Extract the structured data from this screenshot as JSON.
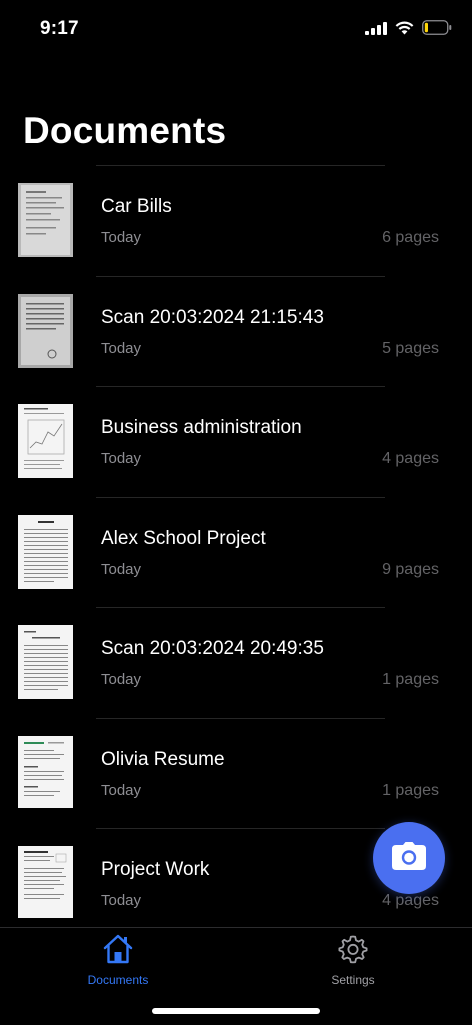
{
  "status_bar": {
    "time": "9:17"
  },
  "page": {
    "title": "Documents"
  },
  "documents": [
    {
      "name": "Car Bills",
      "date": "Today",
      "pages": "6 pages",
      "thumb_style": "photo"
    },
    {
      "name": "Scan 20:03:2024 21:15:43",
      "date": "Today",
      "pages": "5 pages",
      "thumb_style": "photo"
    },
    {
      "name": "Business administration",
      "date": "Today",
      "pages": "4 pages",
      "thumb_style": "page"
    },
    {
      "name": "Alex School Project",
      "date": "Today",
      "pages": "9 pages",
      "thumb_style": "page"
    },
    {
      "name": "Scan 20:03:2024 20:49:35",
      "date": "Today",
      "pages": "1 pages",
      "thumb_style": "page"
    },
    {
      "name": "Olivia Resume",
      "date": "Today",
      "pages": "1 pages",
      "thumb_style": "page"
    },
    {
      "name": "Project Work",
      "date": "Today",
      "pages": "4 pages",
      "thumb_style": "page"
    }
  ],
  "fab": {
    "icon": "camera-icon",
    "color": "#4a6ff0"
  },
  "tabs": [
    {
      "label": "Documents",
      "icon": "house-icon",
      "active": true,
      "color": "#3478f6"
    },
    {
      "label": "Settings",
      "icon": "gear-icon",
      "active": false,
      "color": "#a0a0a5"
    }
  ]
}
